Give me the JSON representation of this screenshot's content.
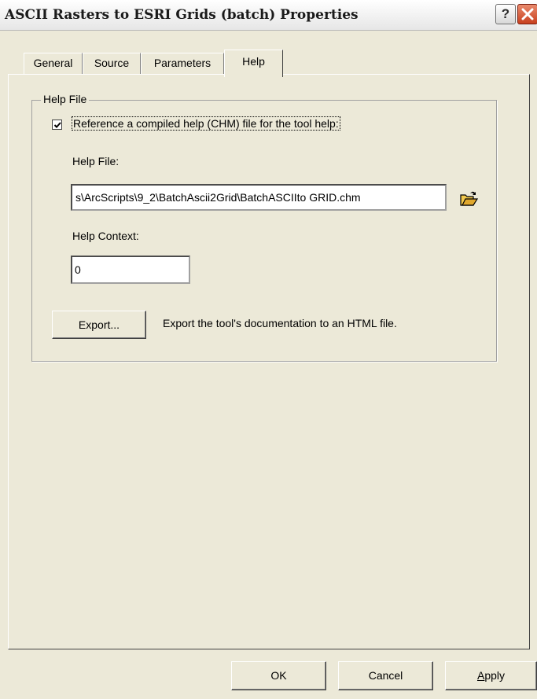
{
  "window": {
    "title": "ASCII Rasters to ESRI Grids (batch) Properties",
    "help_button": "?",
    "icons": {
      "close": "close-icon",
      "help": "question-icon",
      "browse": "open-folder-icon",
      "check": "checkmark-icon"
    }
  },
  "tabs": [
    {
      "label": "General",
      "active": false
    },
    {
      "label": "Source",
      "active": false
    },
    {
      "label": "Parameters",
      "active": false
    },
    {
      "label": "Help",
      "active": true
    }
  ],
  "help_section": {
    "group_title": "Help File",
    "checkbox_label": "Reference a compiled help (CHM) file for the tool help:",
    "checkbox_checked": true,
    "help_file_label": "Help File:",
    "help_file_value": "s\\ArcScripts\\9_2\\BatchAscii2Grid\\BatchASCIIto GRID.chm",
    "help_context_label": "Help Context:",
    "help_context_value": "0",
    "export_button": "Export...",
    "export_description": "Export the tool's documentation to an HTML file."
  },
  "buttons": {
    "ok": "OK",
    "cancel": "Cancel",
    "apply_prefix": "A",
    "apply_rest": "pply"
  }
}
